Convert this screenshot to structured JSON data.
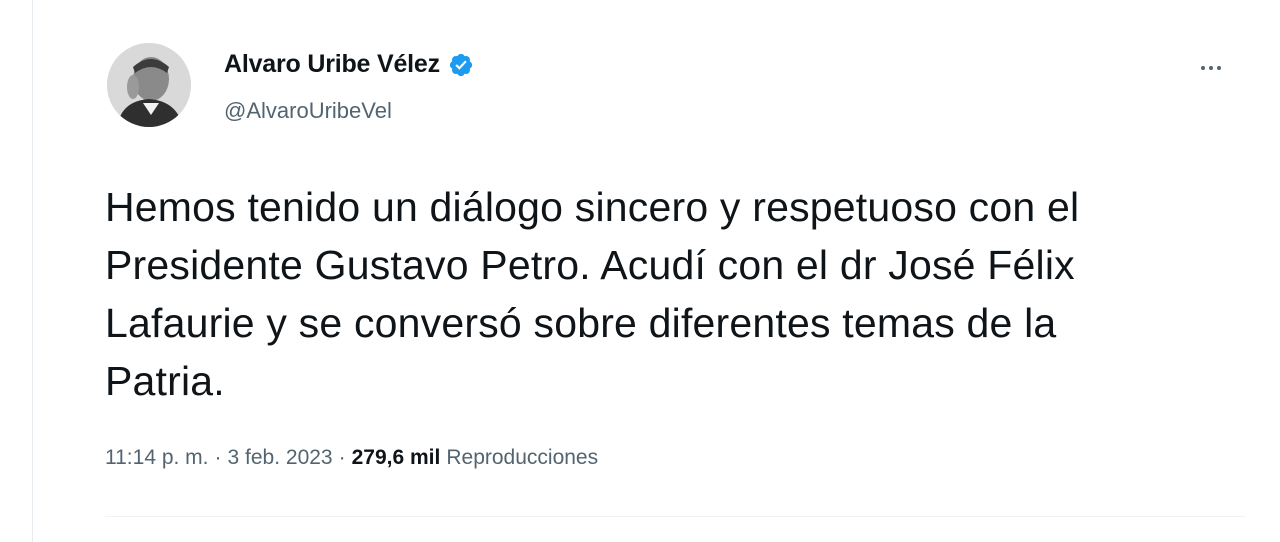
{
  "author": {
    "display_name": "Alvaro Uribe Vélez",
    "handle": "@AlvaroUribeVel",
    "verified_color": "#1d9bf0"
  },
  "tweet": {
    "lines": [
      "Hemos tenido un diálogo sincero y respetuoso con el",
      "Presidente Gustavo Petro. Acudí con el dr José Félix",
      "Lafaurie y se conversó sobre diferentes temas de la",
      "Patria."
    ]
  },
  "meta": {
    "time": "11:14 p. m.",
    "separator": "·",
    "date": "3 feb. 2023",
    "views_count": "279,6 mil",
    "views_label": "Reproducciones"
  },
  "icons": {
    "more": "more-icon",
    "verified": "verified-badge-icon"
  }
}
